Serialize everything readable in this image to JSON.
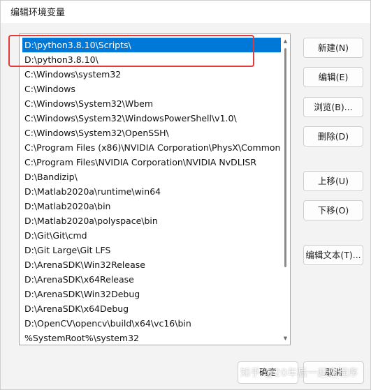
{
  "window": {
    "title": "编辑环境变量"
  },
  "path_list": {
    "items": [
      {
        "text": "D:\\python3.8.10\\Scripts\\",
        "selected": true
      },
      {
        "text": "D:\\python3.8.10\\",
        "selected": false
      },
      {
        "text": "C:\\Windows\\system32",
        "selected": false
      },
      {
        "text": "C:\\Windows",
        "selected": false
      },
      {
        "text": "C:\\Windows\\System32\\Wbem",
        "selected": false
      },
      {
        "text": "C:\\Windows\\System32\\WindowsPowerShell\\v1.0\\",
        "selected": false
      },
      {
        "text": "C:\\Windows\\System32\\OpenSSH\\",
        "selected": false
      },
      {
        "text": "C:\\Program Files (x86)\\NVIDIA Corporation\\PhysX\\Common",
        "selected": false
      },
      {
        "text": "C:\\Program Files\\NVIDIA Corporation\\NVIDIA NvDLISR",
        "selected": false
      },
      {
        "text": "D:\\Bandizip\\",
        "selected": false
      },
      {
        "text": "D:\\Matlab2020a\\runtime\\win64",
        "selected": false
      },
      {
        "text": "D:\\Matlab2020a\\bin",
        "selected": false
      },
      {
        "text": "D:\\Matlab2020a\\polyspace\\bin",
        "selected": false
      },
      {
        "text": "D:\\Git\\Git\\cmd",
        "selected": false
      },
      {
        "text": "D:\\Git Large\\Git LFS",
        "selected": false
      },
      {
        "text": "D:\\ArenaSDK\\Win32Release",
        "selected": false
      },
      {
        "text": "D:\\ArenaSDK\\x64Release",
        "selected": false
      },
      {
        "text": "D:\\ArenaSDK\\Win32Debug",
        "selected": false
      },
      {
        "text": "D:\\ArenaSDK\\x64Debug",
        "selected": false
      },
      {
        "text": "D:\\OpenCV\\opencv\\build\\x64\\vc16\\bin",
        "selected": false
      },
      {
        "text": "%SystemRoot%\\system32",
        "selected": false
      }
    ]
  },
  "buttons": {
    "new": "新建(N)",
    "edit": "编辑(E)",
    "browse": "浏览(B)...",
    "delete": "删除(D)",
    "move_up": "上移(U)",
    "move_down": "下移(O)",
    "edit_text": "编辑文本(T)...",
    "ok": "确定",
    "cancel": "取消"
  },
  "watermark": "知乎 @20年后一起造程序",
  "colors": {
    "selection": "#0078d7",
    "highlight_box": "#e23a3a",
    "window_bg": "#f3f3f3"
  }
}
